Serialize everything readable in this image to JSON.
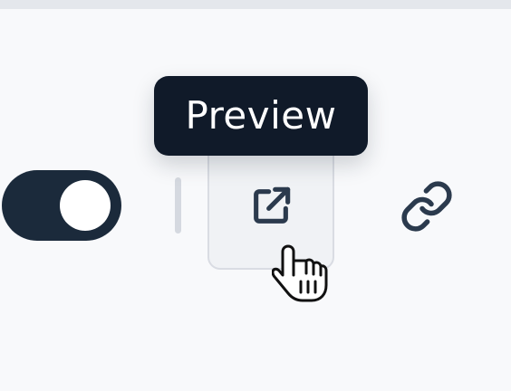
{
  "toolbar": {
    "toggle": {
      "state": "on"
    },
    "preview_button": {
      "icon": "external-link-icon",
      "tooltip": "Preview"
    },
    "link_button": {
      "icon": "link-icon"
    }
  },
  "colors": {
    "toggle_track": "#1b2a3b",
    "tooltip_background": "#101a29",
    "icon": "#2b3a4d",
    "background": "#f8f9fb"
  }
}
